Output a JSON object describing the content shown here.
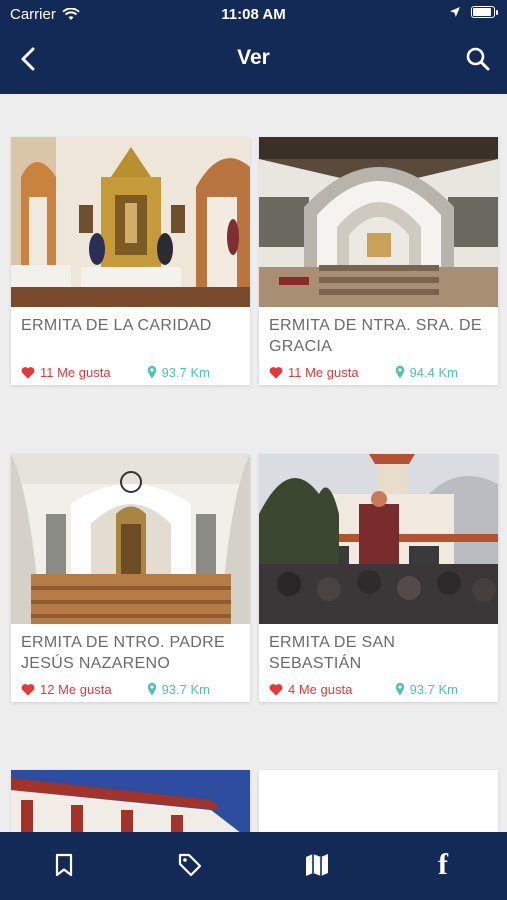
{
  "status_bar": {
    "carrier": "Carrier",
    "time": "11:08 AM"
  },
  "nav": {
    "title": "Ver",
    "back_icon": "chevron-left-icon",
    "search_icon": "search-icon"
  },
  "colors": {
    "header": "#132a57",
    "likes": "#e4383b",
    "distance": "#4fc2b4",
    "background": "#ededed"
  },
  "cards": [
    {
      "title": "ERMITA DE LA CARIDAD",
      "likes": "11 Me gusta",
      "distance": "93.7 Km"
    },
    {
      "title": "ERMITA DE NTRA. SRA. DE GRACIA",
      "likes": "11 Me gusta",
      "distance": "94.4 Km"
    },
    {
      "title": "ERMITA DE NTRO. PADRE JESÚS NAZARENO",
      "likes": "12 Me gusta",
      "distance": "93.7 Km"
    },
    {
      "title": "ERMITA DE SAN SEBASTIÁN",
      "likes": "4 Me gusta",
      "distance": "93.7 Km"
    }
  ],
  "tabbar": {
    "items": [
      "bookmark-icon",
      "tag-icon",
      "map-icon",
      "facebook-icon"
    ],
    "facebook_glyph": "f"
  }
}
